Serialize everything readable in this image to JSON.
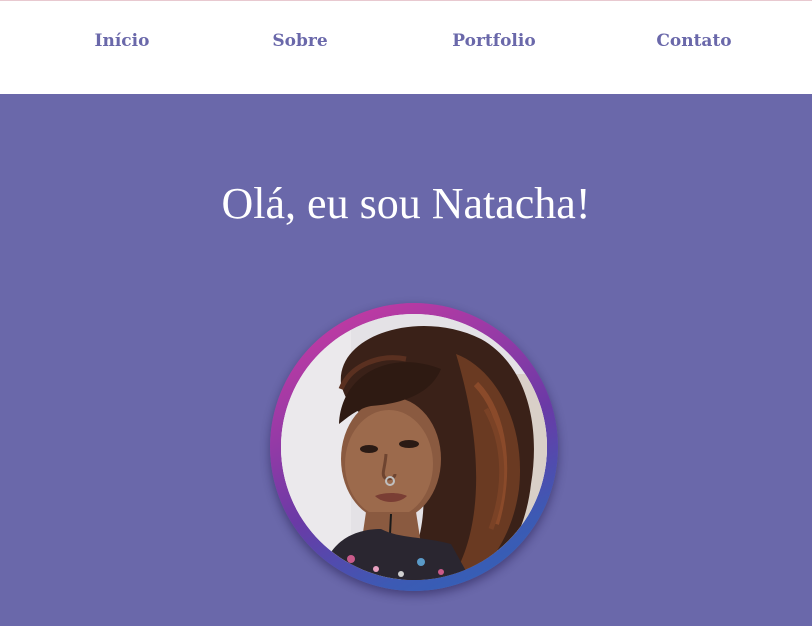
{
  "nav": {
    "items": [
      {
        "label": "Início"
      },
      {
        "label": "Sobre"
      },
      {
        "label": "Portfolio"
      },
      {
        "label": "Contato"
      }
    ]
  },
  "hero": {
    "title": "Olá, eu sou Natacha!"
  },
  "colors": {
    "background": "#6a68aa",
    "nav_background": "#ffffff",
    "nav_text": "#6a68aa",
    "ring_gradient_start": "#d23aa0",
    "ring_gradient_end": "#2e64b8"
  },
  "avatar": {
    "icon": "profile-photo"
  }
}
